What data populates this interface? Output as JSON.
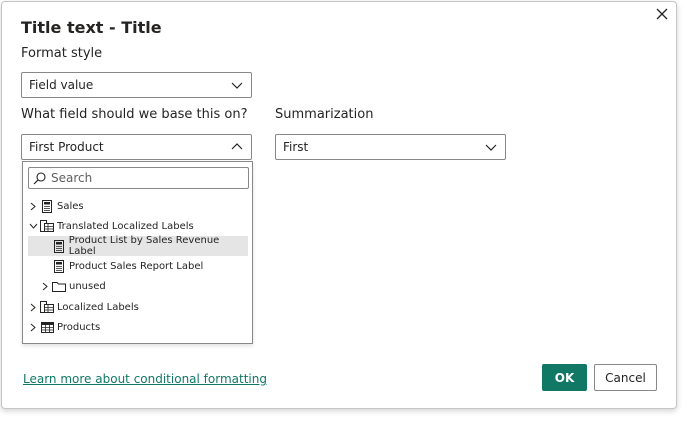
{
  "dialog": {
    "title": "Title text - Title",
    "format_style_label": "Format style",
    "format_style_value": "Field value",
    "base_field_label": "What field should we base this on?",
    "base_field_value": "First Product",
    "summarization_label": "Summarization",
    "summarization_value": "First",
    "learn_more_link": "Learn more about conditional formatting",
    "ok_label": "OK",
    "cancel_label": "Cancel"
  },
  "field_picker": {
    "search_placeholder": "Search",
    "items": [
      {
        "label": "Sales",
        "icon": "table-calc-icon",
        "expanded": false,
        "level": 0
      },
      {
        "label": "Translated Localized Labels",
        "icon": "table-icon",
        "expanded": true,
        "level": 0
      },
      {
        "label": "Product List by Sales Revenue Label",
        "icon": "measure-icon",
        "level": 1,
        "selected": true
      },
      {
        "label": "Product Sales Report Label",
        "icon": "measure-icon",
        "level": 1
      },
      {
        "label": "unused",
        "icon": "folder-icon",
        "expanded": false,
        "level": 1
      },
      {
        "label": "Localized Labels",
        "icon": "table-icon",
        "expanded": false,
        "level": 0
      },
      {
        "label": "Products",
        "icon": "grid-table-icon",
        "expanded": false,
        "level": 0
      }
    ]
  },
  "colors": {
    "accent": "#117865",
    "selected_row": "#e5e5e5",
    "border": "#8a8886"
  }
}
